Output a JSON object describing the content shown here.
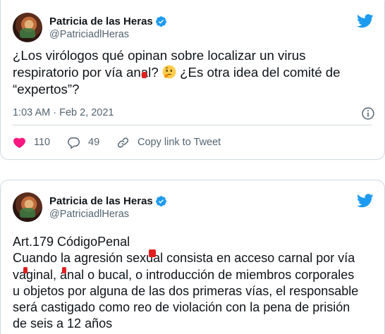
{
  "colors": {
    "twitter_blue": "#1d9bf0",
    "text": "#0f1419",
    "secondary": "#536471",
    "border": "#cfd9de",
    "redaction": "#e0201f"
  },
  "tweets": [
    {
      "author_name": "Patricia de las Heras",
      "handle": "@PatriciadlHeras",
      "text_part1": "¿Los virólogos qué opinan sobre localizar un virus\nrespiratorio por vía anal? ",
      "emoji": "thinking-face-emoji",
      "text_part2": " ¿Es otra idea del comité de\n“expertos”?",
      "timestamp": "1:03 AM · Feb 2, 2021",
      "likes": "110",
      "replies": "49",
      "copy_link_label": "Copy link to Tweet"
    },
    {
      "author_name": "Patricia de las Heras",
      "handle": "@PatriciadlHeras",
      "text": "Art.179 CódigoPenal\nCuando la agresión sexual consista en acceso carnal por vía\nvaginal, anal o bucal, o introducción de miembros corporales\nu objetos por alguna de las dos primeras vías, el responsable\nserá castigado como reo de violación con la pena de prisión\nde seis a 12 años"
    }
  ]
}
